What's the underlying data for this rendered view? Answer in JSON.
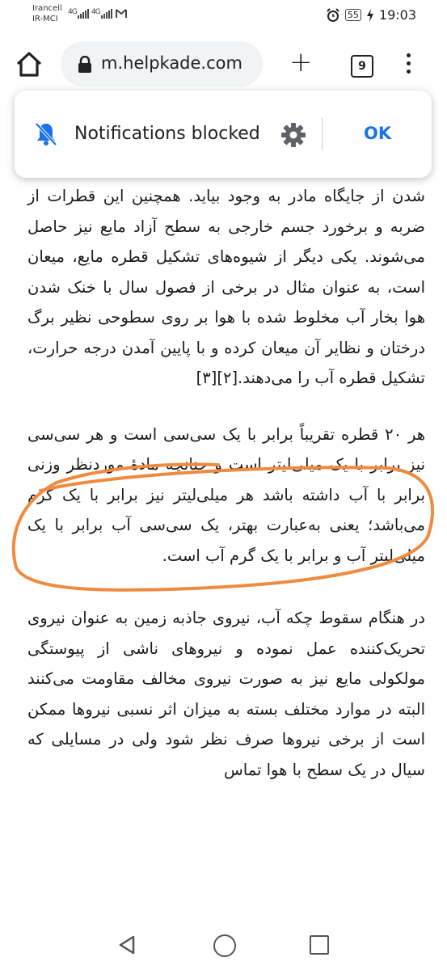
{
  "status_bar": {
    "carrier1": "Irancell",
    "carrier2": "IR-MCI",
    "signal1": "4G",
    "signal2": "4G",
    "battery": "55",
    "time": "19:03"
  },
  "browser": {
    "url": "m.helpkade.com",
    "tab_count": "9"
  },
  "notification": {
    "text": "Notifications blocked",
    "ok_label": "OK"
  },
  "article": {
    "para1": "شدن از جایگاه مادر به وجود بیاید. همچنین این قطرات از ضربه و برخورد جسم خارجی به سطح آزاد مایع نیز حاصل می‌شوند. یکی دیگر از شیوه‌های تشکیل قطره مایع، میعان است، به عنوان مثال در برخی از فصول سال با خنک شدن هوا بخار آب مخلوط شده با هوا بر روی سطوحی نظیر برگ درختان و نظایر آن میعان کرده و با پایین آمدن درجه حرارت، تشکیل قطره آب را می‌دهند.[۲][۳]",
    "para2": "هر ۲۰ قطره تقریباً برابر با یک سی‌سی است و هر سی‌سی نیز برابر با یک میلی‌لیتر است و چنانچه مادهٔ موردنظر وزنی برابر با آب داشته باشد هر میلی‌لیتر نیز برابر با یک گرم می‌باشد؛ یعنی به‌عبارت بهتر، یک سی‌سی آب برابر با یک میلی‌لیتر آب و برابر با یک گرم آب است.",
    "para3": "در هنگام سقوط چکه آب، نیروی جاذبه زمین به عنوان نیروی تحریک‌کننده عمل نموده و نیروهای ناشی از پیوستگی مولکولی مایع نیز به صورت نیروی مخالف مقاومت می‌کنند البته در موارد مختلف بسته به میزان اثر نسبی نیروها ممکن است از برخی نیروها صرف نظر شود ولی در مسایلی که سیال در یک سطح با هوا تماس"
  },
  "colors": {
    "accent": "#1a73e8",
    "marker": "#f08a3e"
  }
}
